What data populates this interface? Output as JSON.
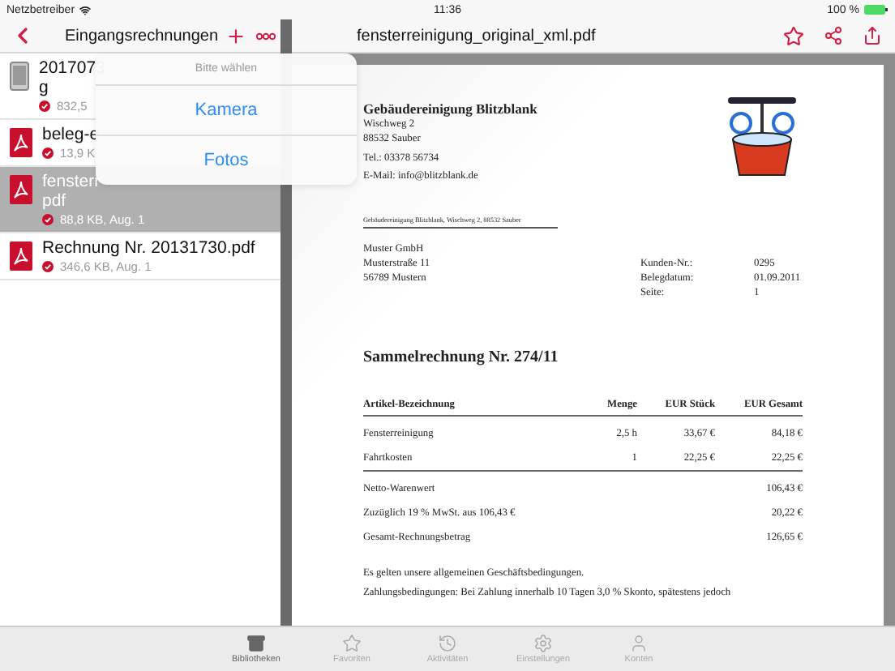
{
  "status_bar": {
    "carrier": "Netzbetreiber",
    "time": "11:36",
    "battery": "100 %"
  },
  "library": {
    "title": "Eingangsrechnungen",
    "files": [
      {
        "kind": "device",
        "title": "2017073\ng",
        "info": "832,5",
        "selected": false
      },
      {
        "kind": "pdf",
        "title": "beleg-e",
        "info": "13,9 K",
        "selected": false
      },
      {
        "kind": "pdf",
        "title": "fensterr\npdf",
        "info": "88,8 KB, Aug. 1",
        "selected": true
      },
      {
        "kind": "pdf",
        "title": "Rechnung Nr. 20131730.pdf",
        "info": "346,6 KB, Aug. 1",
        "selected": false
      }
    ]
  },
  "popover": {
    "title": "Bitte wählen",
    "options": [
      "Kamera",
      "Fotos"
    ]
  },
  "viewer": {
    "title": "fensterreinigung_original_xml.pdf",
    "document": {
      "sender_name": "Gebäudereinigung Blitzblank",
      "sender_lines": [
        "Wischweg 2",
        "88532 Sauber"
      ],
      "contact_lines": [
        "Tel.: 03378 56734",
        "E-Mail: info@blitzblank.de"
      ],
      "return_address": "Gebäudereinigung Blitzblank, Wischweg 2, 88532 Sauber",
      "recipient": [
        "Muster GmbH",
        "Musterstraße 11",
        "56789 Mustern"
      ],
      "meta": [
        {
          "label": "Kunden-Nr.:",
          "value": "0295"
        },
        {
          "label": "Belegdatum:",
          "value": "01.09.2011"
        },
        {
          "label": "Seite:",
          "value": "1"
        }
      ],
      "title": "Sammelrechnung Nr. 274/11",
      "columns": [
        "Artikel-Bezeichnung",
        "Menge",
        "EUR Stück",
        "EUR Gesamt"
      ],
      "rows": [
        [
          "Fensterreinigung",
          "2,5 h",
          "33,67 €",
          "84,18 €"
        ],
        [
          "Fahrtkosten",
          "1",
          "22,25 €",
          "22,25 €"
        ]
      ],
      "totals": [
        {
          "label": "Netto-Warenwert",
          "value": "106,43 €"
        },
        {
          "label": "Zuzüglich 19 % MwSt. aus 106,43 €",
          "value": "20,22 €"
        },
        {
          "label": "Gesamt-Rechnungsbetrag",
          "value": "126,65 €"
        }
      ],
      "notes": [
        "Es gelten unsere allgemeinen Geschäftsbedingungen.",
        "Zahlungsbedingungen: Bei Zahlung innerhalb 10 Tagen 3,0 % Skonto, spätestens jedoch"
      ]
    }
  },
  "tab_bar": [
    {
      "label": "Bibliotheken",
      "selected": true
    },
    {
      "label": "Favoriten",
      "selected": false
    },
    {
      "label": "Aktivitäten",
      "selected": false
    },
    {
      "label": "Einstellungen",
      "selected": false
    },
    {
      "label": "Konten",
      "selected": false
    }
  ]
}
